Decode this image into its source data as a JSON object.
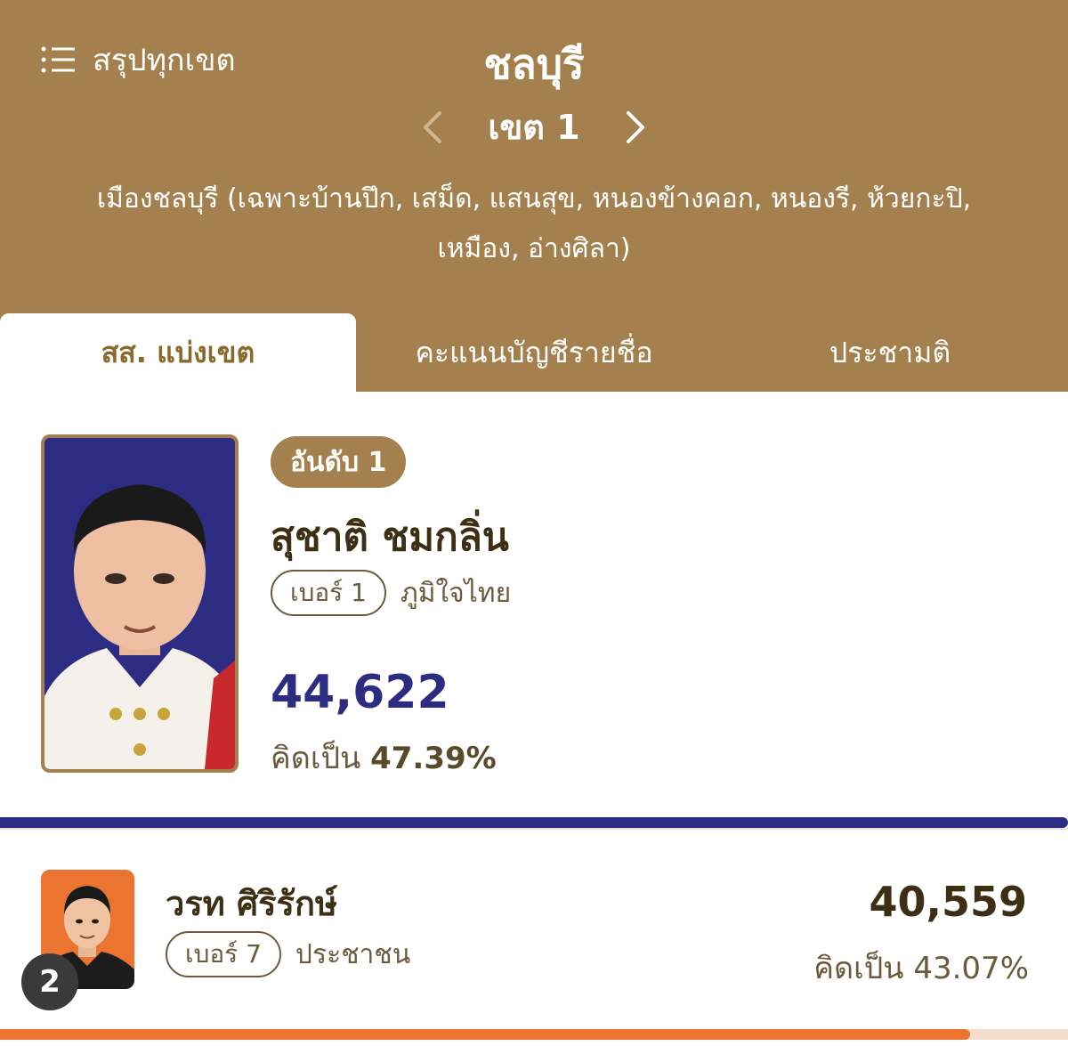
{
  "header": {
    "summary_label": "สรุปทุกเขต",
    "province": "ชลบุรี",
    "district": "เขต 1",
    "area_description": "เมืองชลบุรี (เฉพาะบ้านปึก, เสม็ด, แสนสุข, หนองข้างคอก, หนองรี, ห้วยกะปิ, เหมือง, อ่างศิลา)"
  },
  "tabs": [
    {
      "label": "สส. แบ่งเขต",
      "active": true
    },
    {
      "label": "คะแนนบัญชีรายชื่อ",
      "active": false
    },
    {
      "label": "ประชามติ",
      "active": false
    }
  ],
  "candidates": [
    {
      "rank_label": "อันดับ 1",
      "rank": 1,
      "name": "สุชาติ ชมกลิ่น",
      "number_label": "เบอร์ 1",
      "party": "ภูมิใจไทย",
      "votes": "44,622",
      "percent_prefix": "คิดเป็น",
      "percent": "47.39%",
      "share": 0.4739,
      "color": "#2d2c83"
    },
    {
      "rank": "2",
      "name": "วรท ศิริรักษ์",
      "number_label": "เบอร์ 7",
      "party": "ประชาชน",
      "votes": "40,559",
      "percent_text": "คิดเป็น 43.07%",
      "share": 0.4307,
      "color": "#ec7431"
    }
  ],
  "colors": {
    "header_bg": "#a3804e",
    "winner_party": "#2d2c83",
    "runner_party": "#ec7431"
  }
}
